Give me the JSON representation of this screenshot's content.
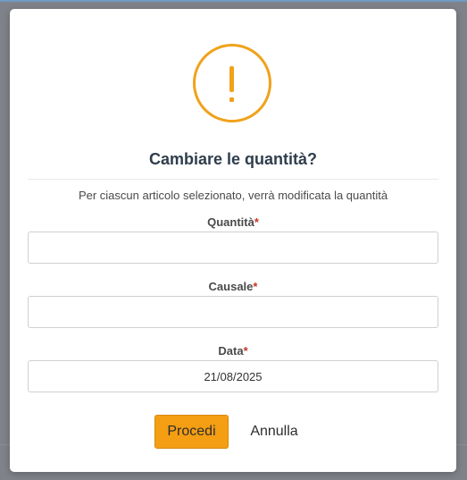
{
  "dialog": {
    "icon": "warning-exclamation-icon",
    "icon_color": "#f0a21b",
    "title": "Cambiare le quantità?",
    "subtitle": "Per ciascun articolo selezionato, verrà modificata la quantità",
    "fields": [
      {
        "label": "Quantità",
        "required_mark": "*",
        "value": ""
      },
      {
        "label": "Causale",
        "required_mark": "*",
        "value": ""
      },
      {
        "label": "Data",
        "required_mark": "*",
        "value": "21/08/2025"
      }
    ],
    "confirm_label": "Procedi",
    "cancel_label": "Annulla",
    "accent_color": "#f49e14"
  }
}
